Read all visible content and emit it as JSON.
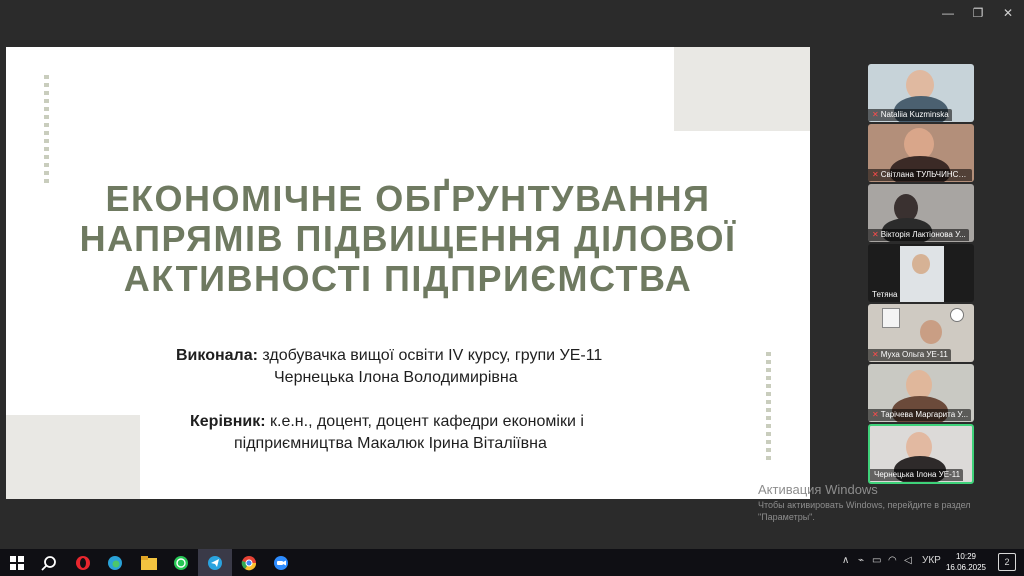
{
  "window": {
    "minimize_icon": "minimize-icon",
    "restore_icon": "restore-icon",
    "close_icon": "close-icon"
  },
  "slide": {
    "title_lines": [
      "ЕКОНОМІЧНЕ ОБҐРУНТУВАННЯ",
      "НАПРЯМІВ ПІДВИЩЕННЯ ДІЛОВОЇ",
      "АКТИВНОСТІ ПІДПРИЄМСТВА"
    ],
    "author_label": "Виконала:",
    "author_line1": " здобувачка вищої освіти IV курсу, групи УЕ-11",
    "author_line2": "Чернецька Ілона Володимирівна",
    "supervisor_label": "Керівник:",
    "supervisor_line1": " к.е.н., доцент, доцент кафедри економіки і",
    "supervisor_line2": "підприємництва Макалюк Ірина Віталіївна"
  },
  "participants": [
    {
      "name": "Nataliia Kuzminska",
      "muted": true
    },
    {
      "name": "Світлана ТУЛЬЧИНСЬ...",
      "muted": true
    },
    {
      "name": "Вікторія Лактіонова У...",
      "muted": true
    },
    {
      "name": "Тетяна",
      "muted": false
    },
    {
      "name": "Муха Ольга УЕ-11",
      "muted": true
    },
    {
      "name": "Тарічева Маргарита У...",
      "muted": true
    },
    {
      "name": "Чернецька Ілона УЕ-11",
      "muted": false,
      "active": true
    }
  ],
  "watermark": {
    "title": "Активация Windows",
    "text": "Чтобы активировать Windows, перейдите в раздел \"Параметры\"."
  },
  "taskbar": {
    "icons": [
      "windows-start-icon",
      "search-icon",
      "opera-icon",
      "edge-icon",
      "file-explorer-icon",
      "whatsapp-icon",
      "telegram-icon",
      "chrome-icon",
      "zoom-icon"
    ],
    "language": "УКР",
    "time": "10:29",
    "date": "16.06.2025",
    "notifications": "2"
  }
}
